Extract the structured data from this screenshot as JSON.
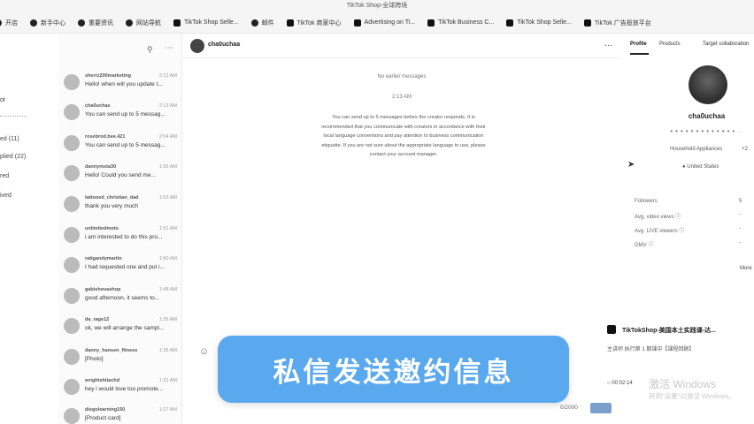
{
  "window": {
    "title": "TikTok Shop-全球跨境"
  },
  "bookmarks": [
    {
      "label": "开店"
    },
    {
      "label": "新手中心"
    },
    {
      "label": "重要资讯"
    },
    {
      "label": "网站导航"
    },
    {
      "label": "TikTok Shop Selle..."
    },
    {
      "label": "邮件"
    },
    {
      "label": "TikTok 商家中心"
    },
    {
      "label": "Advertising on Ti..."
    },
    {
      "label": "TikTok Business C..."
    },
    {
      "label": "TikTok Shop Selle..."
    },
    {
      "label": "TikTok 广告投放平台"
    }
  ],
  "left_nav": [
    {
      "label": "ot"
    },
    {
      "label": "ed (11)"
    },
    {
      "label": "plied (22)"
    },
    {
      "label": "red"
    },
    {
      "label": "ived"
    }
  ],
  "conversations": [
    {
      "name": "sherrz200marketing",
      "time": "2:13 AM",
      "preview": "Hello! when will you update t..."
    },
    {
      "name": "cha0uchas",
      "time": "2:13 AM",
      "preview": "You can send up to 5 messag..."
    },
    {
      "name": "rosebrod.bee.421",
      "time": "2:04 AM",
      "preview": "You can send up to 5 messag..."
    },
    {
      "name": "dannymsta30",
      "time": "1:56 AM",
      "preview": "Hello! Could you send me..."
    },
    {
      "name": "tattooed_christian_dad",
      "time": "1:53 AM",
      "preview": "thank you very much"
    },
    {
      "name": "unlimitedmoto",
      "time": "1:51 AM",
      "preview": "i am interested to do this pro..."
    },
    {
      "name": "ratigandymartin",
      "time": "1:50 AM",
      "preview": "I had requested one and put i..."
    },
    {
      "name": "gabishovashop",
      "time": "1:48 AM",
      "preview": "good afternoon, it seems to..."
    },
    {
      "name": "da_rage12",
      "time": "1:35 AM",
      "preview": "ok, we will arrange the sampl..."
    },
    {
      "name": "danny_hansen_fitness",
      "time": "1:35 AM",
      "preview": "[Photo]"
    },
    {
      "name": "wrightshitachd",
      "time": "1:31 AM",
      "preview": "hey i would love too promote..."
    },
    {
      "name": "diegolearning150",
      "time": "1:27 AM",
      "preview": "[Product card]"
    }
  ],
  "chat": {
    "contact_name": "cha0uchaa",
    "no_earlier": "No earlier messages",
    "time": "2:13 AM",
    "notice": "You can send up to 5 messages before the creator responds. It is recommended that you communicate with creators in accordance with their local language conventions and pay attention to business communication etiquette. If you are not sure about the appropriate language to use, please contact your account manager.",
    "char_count": "0/2000"
  },
  "profile": {
    "tabs": [
      {
        "label": "Profile"
      },
      {
        "label": "Products"
      },
      {
        "label": "Target collaboration"
      }
    ],
    "name": "cha0uchaa",
    "handle": "● ● ● ● ● ● ● ● ● ● ● ● ● ...",
    "category": "Household Appliances",
    "category_more": "+2",
    "location": "United States",
    "stats": [
      {
        "label": "Followers",
        "value": "5"
      },
      {
        "label": "Avg. video views",
        "value": "-"
      },
      {
        "label": "Avg. LIVE viewers",
        "value": "-"
      },
      {
        "label": "GMV",
        "value": "-"
      }
    ],
    "more": "More",
    "card_title": "TikTokShop-美国本土实践课-达...",
    "card_sub": "主讲师 执行第 1 期课中【课程回顾】",
    "video_time": "00:02:14"
  },
  "watermark": {
    "line1": "激活 Windows",
    "line2": "转到\"设置\"以激活 Windows。"
  },
  "banner": {
    "text": "私信发送邀约信息"
  }
}
